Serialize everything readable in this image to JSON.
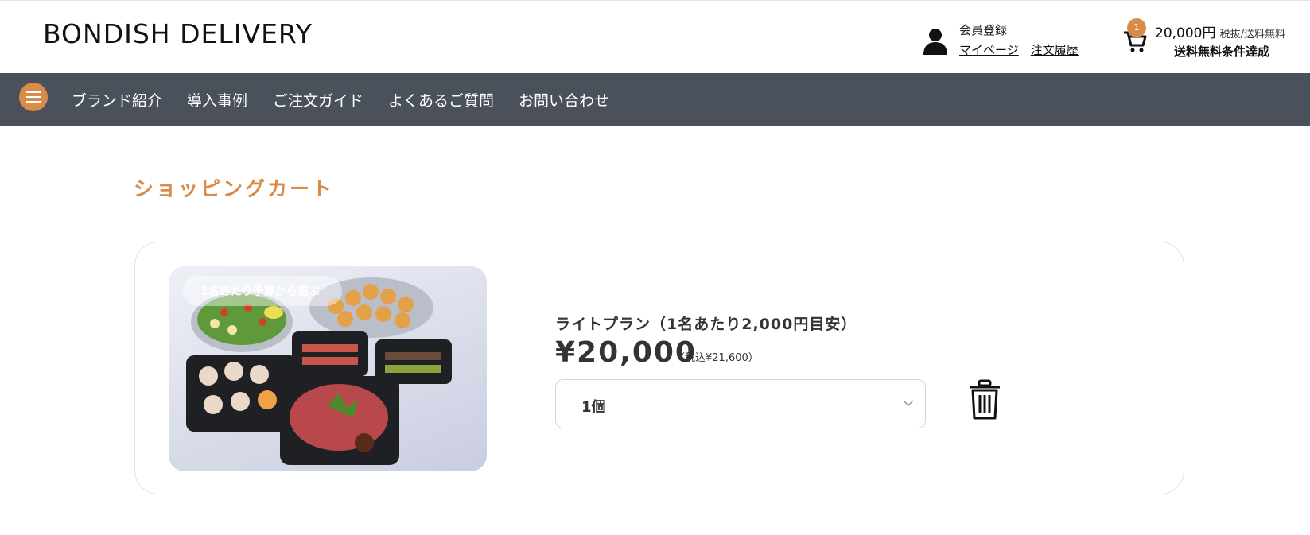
{
  "header": {
    "logo": "BONDISH DELIVERY",
    "account": {
      "register_label": "会員登録",
      "mypage_label": "マイページ",
      "order_history_label": "注文履歴"
    },
    "cart": {
      "badge_count": "1",
      "total": "20,000円",
      "tax_note": "税抜/送料無料",
      "free_shipping_status": "送料無料条件達成"
    }
  },
  "nav": {
    "items": [
      {
        "label": "ブランド紹介"
      },
      {
        "label": "導入事例"
      },
      {
        "label": "ご注文ガイド"
      },
      {
        "label": "よくあるご質問"
      },
      {
        "label": "お問い合わせ"
      }
    ]
  },
  "page": {
    "title": "ショッピングカート"
  },
  "cart_item": {
    "image_tag": "1名あたり予算から選ぶ",
    "name": "ライトプラン（1名あたり2,000円目安）",
    "price": "¥20,000",
    "price_with_tax": "（税込¥21,600）",
    "quantity": "1個"
  },
  "colors": {
    "accent": "#d98c4a",
    "nav_background": "#4a515b"
  }
}
